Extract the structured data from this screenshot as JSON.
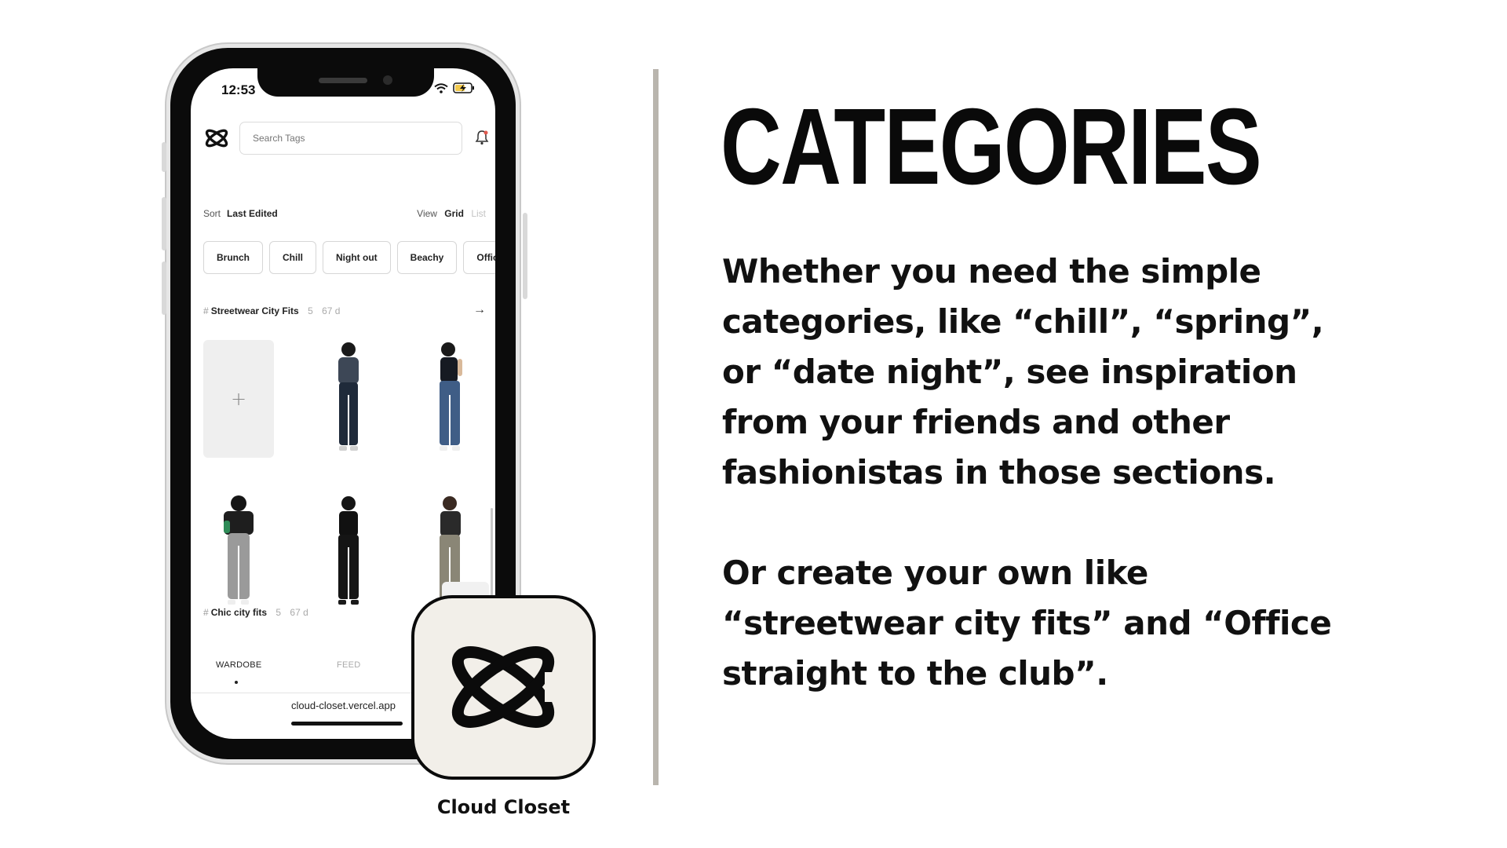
{
  "slide": {
    "title": "CATEGORIES",
    "paragraph1": "Whether you need the simple categories, like “chill”, “spring”, or “date night”, see inspiration from your friends and other fashionistas in those sections.",
    "paragraph2": "Or create your own like “streetwear city fits” and “Office straight to the club”."
  },
  "app_icon": {
    "name": "Cloud Closet",
    "bg_color": "#f2efe9"
  },
  "phone": {
    "status": {
      "time": "12:53"
    },
    "search": {
      "placeholder": "Search Tags"
    },
    "sort": {
      "label": "Sort",
      "value": "Last Edited"
    },
    "view": {
      "label": "View",
      "options": [
        "Grid",
        "List"
      ],
      "selected": "Grid"
    },
    "chips": [
      "Brunch",
      "Chill",
      "Night out",
      "Beachy",
      "Office"
    ],
    "sections": [
      {
        "title": "Streetwear City Fits",
        "count": "5",
        "age": "67 d"
      },
      {
        "title": "Chic city fits",
        "count": "5",
        "age": "67 d"
      }
    ],
    "nav": {
      "wardrobe": "WARDOBE",
      "feed": "FEED"
    },
    "url": "cloud-closet.vercel.app"
  }
}
